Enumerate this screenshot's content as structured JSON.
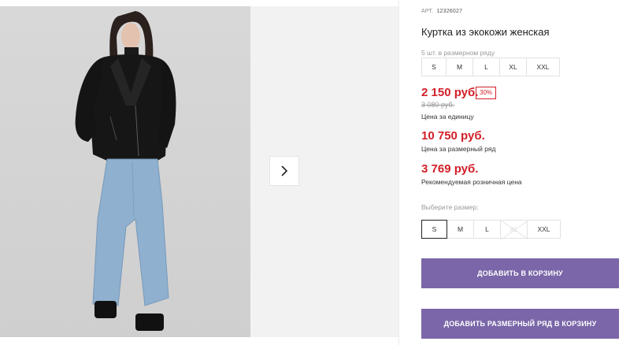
{
  "product": {
    "article_label": "АРТ.",
    "article_number": "12326027",
    "title": "Куртка из экокожи женская",
    "row_label": "5 шт. в размерном ряду",
    "row_sizes": [
      "S",
      "M",
      "L",
      "XL",
      "XXL"
    ]
  },
  "pricing": {
    "unit_price": "2 150 руб.",
    "discount": "30%",
    "old_price": "3 080 руб.",
    "unit_caption": "Цена за единицу",
    "row_price": "10 750 руб.",
    "row_caption": "Цена за размерный ряд",
    "retail_price": "3 769 руб.",
    "retail_caption": "Рекомендуемая розничная цена"
  },
  "size_picker": {
    "label": "Выберите размер:",
    "sizes": [
      "S",
      "M",
      "L",
      "XL",
      "XXL"
    ],
    "selected": "S",
    "unavailable": [
      "XL"
    ]
  },
  "actions": {
    "add_to_cart": "ДОБАВИТЬ В КОРЗИНУ",
    "add_row_to_cart": "ДОБАВИТЬ РАЗМЕРНЫЙ РЯД В КОРЗИНУ"
  },
  "gallery": {
    "next_icon": "chevron-right-icon",
    "image_subject": "woman in black leather jacket and light blue wide jeans"
  },
  "colors": {
    "price_red": "#d21f28",
    "button_purple": "#7a66a8"
  }
}
